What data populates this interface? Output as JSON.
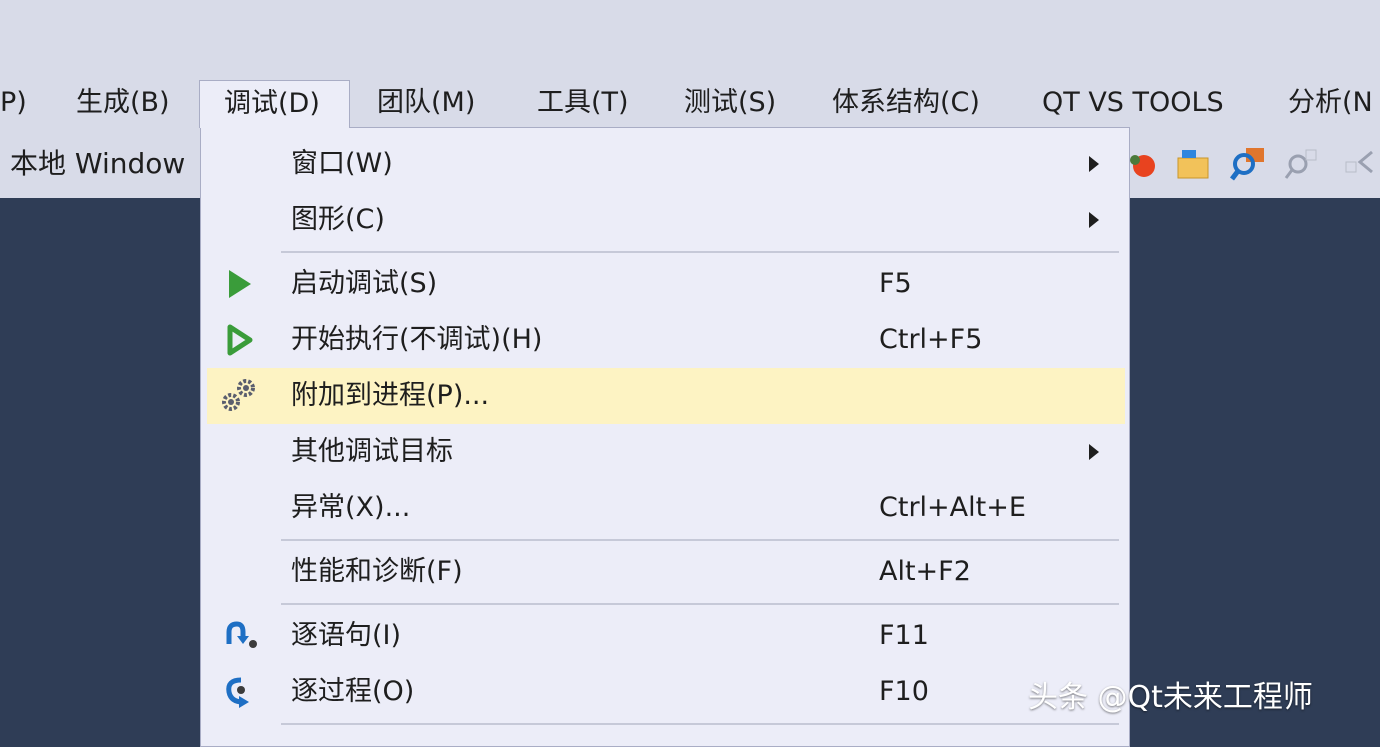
{
  "menubar": {
    "items": [
      {
        "label": "P)"
      },
      {
        "label": "生成(B)"
      },
      {
        "label": "调试(D)"
      },
      {
        "label": "团队(M)"
      },
      {
        "label": "工具(T)"
      },
      {
        "label": "测试(S)"
      },
      {
        "label": "体系结构(C)"
      },
      {
        "label": "QT VS TOOLS"
      },
      {
        "label": "分析(N"
      }
    ]
  },
  "toolbar": {
    "debug_target": "本地 Window",
    "icons": [
      "debug-target-icon",
      "open-folder-icon",
      "find-icon",
      "zoom-icon",
      "back-arrow-icon"
    ]
  },
  "debug_menu": {
    "items": [
      {
        "label": "窗口(W)",
        "shortcut": "",
        "submenu": true
      },
      {
        "label": "图形(C)",
        "shortcut": "",
        "submenu": true
      },
      {
        "label": "启动调试(S)",
        "shortcut": "F5",
        "icon": "play-icon"
      },
      {
        "label": "开始执行(不调试)(H)",
        "shortcut": "Ctrl+F5",
        "icon": "play-outline-icon"
      },
      {
        "label": "附加到进程(P)...",
        "shortcut": "",
        "icon": "gears-icon",
        "highlighted": true
      },
      {
        "label": "其他调试目标",
        "shortcut": "",
        "submenu": true
      },
      {
        "label": "异常(X)...",
        "shortcut": "Ctrl+Alt+E"
      },
      {
        "label": "性能和诊断(F)",
        "shortcut": "Alt+F2"
      },
      {
        "label": "逐语句(I)",
        "shortcut": "F11",
        "icon": "step-into-icon"
      },
      {
        "label": "逐过程(O)",
        "shortcut": "F10",
        "icon": "step-over-icon"
      }
    ]
  },
  "watermark": "头条 @Qt未来工程师",
  "colors": {
    "chrome": "#d8dbe8",
    "menu_bg": "#ecedf8",
    "highlight": "#fdf3c3",
    "editor_bg": "#2f3d56",
    "play_green": "#3a9c3a",
    "step_blue": "#1e6fc4"
  }
}
